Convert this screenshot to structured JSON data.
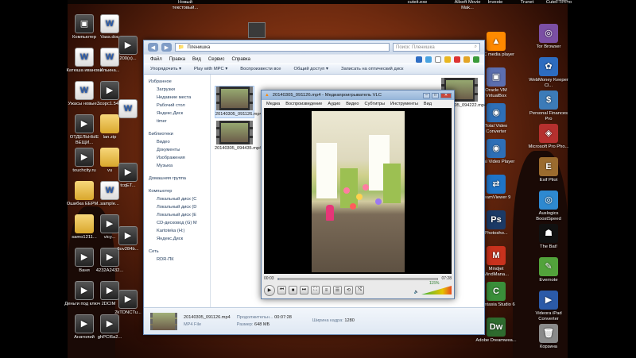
{
  "desktop": {
    "left_icons": [
      {
        "label": "Компьютер",
        "kind": "vid",
        "sym": "▣"
      },
      {
        "label": "Катюша иванова",
        "kind": "doc",
        "sym": "W"
      },
      {
        "label": "Ужасы новые...",
        "kind": "doc",
        "sym": "W"
      },
      {
        "label": "ОТДЕЛЬНЫЕ ВЕЩИ...",
        "kind": "vid",
        "sym": "▶"
      },
      {
        "label": "touchcity.ru",
        "kind": "vid",
        "sym": "▶"
      },
      {
        "label": "Ошибка ЕЕРМ...",
        "kind": "folder",
        "sym": ""
      },
      {
        "label": "samo1211...",
        "kind": "folder",
        "sym": ""
      },
      {
        "label": "Ваня",
        "kind": "vid",
        "sym": "▶"
      },
      {
        "label": "Деньги под ключ 2",
        "kind": "vid",
        "sym": "▶"
      },
      {
        "label": "Анатолий",
        "kind": "vid",
        "sym": "▶"
      }
    ],
    "col2_icons": [
      {
        "label": "Vass.doc",
        "kind": "doc",
        "sym": "W"
      },
      {
        "label": "Ильина...",
        "kind": "doc",
        "sym": "W"
      },
      {
        "label": "Зоэрс1.54...",
        "kind": "vid",
        "sym": "▶"
      },
      {
        "label": "lan.zip",
        "kind": "folder",
        "sym": ""
      },
      {
        "label": "vu",
        "kind": "folder",
        "sym": ""
      },
      {
        "label": "sample...",
        "kind": "doc",
        "sym": "W"
      },
      {
        "label": "vicy...",
        "kind": "vid",
        "sym": "▶"
      },
      {
        "label": "4232A2432...",
        "kind": "vid",
        "sym": "▶"
      },
      {
        "label": "DCIM",
        "kind": "vid",
        "sym": "▶"
      },
      {
        "label": "ghPCI6a2...",
        "kind": "vid",
        "sym": "▶"
      }
    ],
    "col3_icons": [
      {
        "label": "200(x)...",
        "kind": "vid",
        "sym": "▶"
      },
      {
        "label": "",
        "kind": "doc",
        "sym": "W"
      },
      {
        "label": "tcqET...",
        "kind": "vid",
        "sym": "▶"
      },
      {
        "label": "6ov284b...",
        "kind": "vid",
        "sym": "▶"
      },
      {
        "label": "2kTDNCTu...",
        "kind": "vid",
        "sym": "▶"
      }
    ],
    "right_icons_a": [
      {
        "label": "VLC media player",
        "kind": "vlc",
        "sym": "▲"
      },
      {
        "label": "Oracle VM VirtualBox",
        "kind": "vbox",
        "sym": "▣"
      },
      {
        "label": "Total Video Converter",
        "kind": "tvc",
        "sym": "◉"
      },
      {
        "label": "Total Video Player",
        "kind": "tvp",
        "sym": "◉"
      },
      {
        "label": "TeamViewer 9",
        "kind": "tv",
        "sym": "⇄"
      },
      {
        "label": "Photosho...",
        "kind": "ps",
        "sym": "Ps"
      },
      {
        "label": "Mindjet MindMana...",
        "kind": "mm",
        "sym": "M"
      },
      {
        "label": "Camtasia Studio 6",
        "kind": "cam",
        "sym": "C"
      },
      {
        "label": "Adobe Dreamwea...",
        "kind": "dw",
        "sym": "Dw"
      }
    ],
    "right_icons_b": [
      {
        "label": "Tor Browser",
        "kind": "tor",
        "sym": "◎"
      },
      {
        "label": "WebMoney Keeper Cl...",
        "kind": "wm",
        "sym": "✿"
      },
      {
        "label": "Personal Finances Pro",
        "kind": "pf",
        "sym": "$"
      },
      {
        "label": "Microsoft Pro Pho...",
        "kind": "ms",
        "sym": "◈"
      },
      {
        "label": "Exif Pilot",
        "kind": "exif",
        "sym": "E"
      },
      {
        "label": "Auslogics BoostSpeed",
        "kind": "aus",
        "sym": "◎"
      },
      {
        "label": "The Bat!",
        "kind": "bat",
        "sym": "☗"
      },
      {
        "label": "Evernote",
        "kind": "ev",
        "sym": "✎"
      },
      {
        "label": "Videora iPad Converter",
        "kind": "vid2",
        "sym": "▶"
      },
      {
        "label": "Корзина",
        "kind": "bin",
        "sym": "🗑"
      }
    ],
    "top_labels": [
      "Новый текстовый...",
      "Allsoft Movie Mak...",
      "Investe",
      "Trunet",
      "CuteFTPPro",
      "cuteit.exe"
    ]
  },
  "explorer": {
    "address": "Пленишка",
    "search_placeholder": "Поиск: Пленишка",
    "menu": [
      "Файл",
      "Правка",
      "Вид",
      "Сервис",
      "Справка"
    ],
    "toolbar": [
      "Упорядочить ▾",
      "Play with MPC ▾",
      "Воспроизвести все",
      "Общий доступ ▾",
      "Записать на оптический диск"
    ],
    "nav": {
      "favorites": "Избранное",
      "favorites_items": [
        "Загрузки",
        "Недавние места",
        "Рабочий стол",
        "Яндекс.Диск",
        "timer"
      ],
      "libraries": "Библиотеки",
      "libraries_items": [
        "Видео",
        "Документы",
        "Изображения",
        "Музыка"
      ],
      "homegroup": "Домашняя группа",
      "computer": "Компьютер",
      "computer_items": [
        "Локальный диск (C",
        "Локальный диск (D",
        "Локальный диск (E",
        "CD-дисковод (G) М",
        "Kartoteka (H:)",
        "Яндекс.Диск"
      ],
      "network": "Сеть",
      "network_items": [
        "RDR-ПК"
      ]
    },
    "files": [
      {
        "name": "20140305_091126.mp4"
      },
      {
        "name": "20140305_094435.mp4"
      },
      {
        "name": "20140305_094222.mp4"
      }
    ],
    "details": {
      "filename": "20140305_091126.mp4",
      "type": "MP4 File",
      "duration_label": "Продолжительн...",
      "duration": "00:07:28",
      "size_label": "Размер:",
      "size": "648 МБ",
      "width_label": "Ширина кадра:",
      "width": "1280"
    }
  },
  "vlc": {
    "title": "20140305_091126.mp4 - Медиапроигрыватель VLC",
    "menu": [
      "Медиа",
      "Воспроизведение",
      "Аудио",
      "Видео",
      "Субтитры",
      "Инструменты",
      "Вид"
    ],
    "time_current": "00:03",
    "time_total": "07:28",
    "volume": "115%",
    "position_fraction": 0.007
  },
  "colors": {
    "accent": "#4f7cc0",
    "vlc_orange": "#ff8800"
  }
}
